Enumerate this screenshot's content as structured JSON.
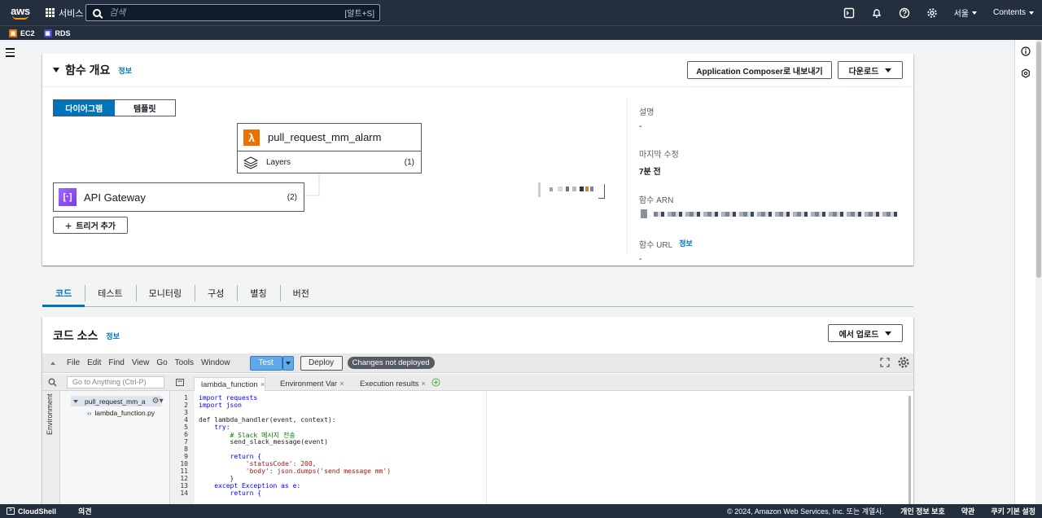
{
  "topnav": {
    "logo_text": "aws",
    "services_label": "서비스",
    "search_placeholder": "검색",
    "search_shortcut": "[알트+S]",
    "region_label": "서울",
    "account_label": "Contents"
  },
  "favorites": [
    {
      "label": "EC2",
      "color": "#ed7100"
    },
    {
      "label": "RDS",
      "color": "#3b48cc"
    }
  ],
  "overview": {
    "title": "함수 개요",
    "info_label": "정보",
    "export_button": "Application Composer로 내보내기",
    "download_button": "다운로드",
    "view_diagram": "다이어그램",
    "view_template": "템플릿",
    "function_name": "pull_request_mm_alarm",
    "layers_label": "Layers",
    "layers_count": "(1)",
    "trigger_name": "API Gateway",
    "trigger_count": "(2)",
    "add_trigger": "트리거 추가",
    "meta": {
      "description_label": "설명",
      "description_value": "-",
      "modified_label": "마지막 수정",
      "modified_value": "7분 전",
      "arn_label": "함수 ARN",
      "url_label": "함수 URL",
      "url_info": "정보",
      "url_value": "-"
    }
  },
  "tabs": [
    {
      "label": "코드",
      "active": true
    },
    {
      "label": "테스트"
    },
    {
      "label": "모니터링"
    },
    {
      "label": "구성"
    },
    {
      "label": "별칭"
    },
    {
      "label": "버전"
    }
  ],
  "code_source": {
    "title": "코드 소스",
    "info_label": "정보",
    "upload_button": "에서 업로드"
  },
  "ide": {
    "menus": [
      "File",
      "Edit",
      "Find",
      "View",
      "Go",
      "Tools",
      "Window"
    ],
    "test_button": "Test",
    "deploy_button": "Deploy",
    "status_chip": "Changes not deployed",
    "goto_placeholder": "Go to Anything (Ctrl-P)",
    "file_tabs": [
      "lambda_function",
      "Environment Var",
      "Execution results"
    ],
    "env_label": "Environment",
    "tree_folder": "pull_request_mm_a",
    "tree_file": "lambda_function.py",
    "code_lines": [
      "import requests",
      "import json",
      "",
      "def lambda_handler(event, context):",
      "    try:",
      "        # Slack 메시지 전송",
      "        send_slack_message(event)",
      "",
      "        return {",
      "            'statusCode': 200,",
      "            'body': json.dumps('send message mm')",
      "        }",
      "    except Exception as e:",
      "        return {"
    ]
  },
  "bottombar": {
    "cloudshell": "CloudShell",
    "feedback": "의견",
    "copyright": "© 2024, Amazon Web Services, Inc. 또는 계열사.",
    "privacy": "개인 정보 보호",
    "terms": "약관",
    "cookies": "쿠키 기본 설정"
  },
  "colors": {
    "nav_bg": "#232f3e",
    "accent": "#0073bb",
    "lambda_orange": "#ed7100",
    "apigw_purple": "#8c4fff"
  }
}
